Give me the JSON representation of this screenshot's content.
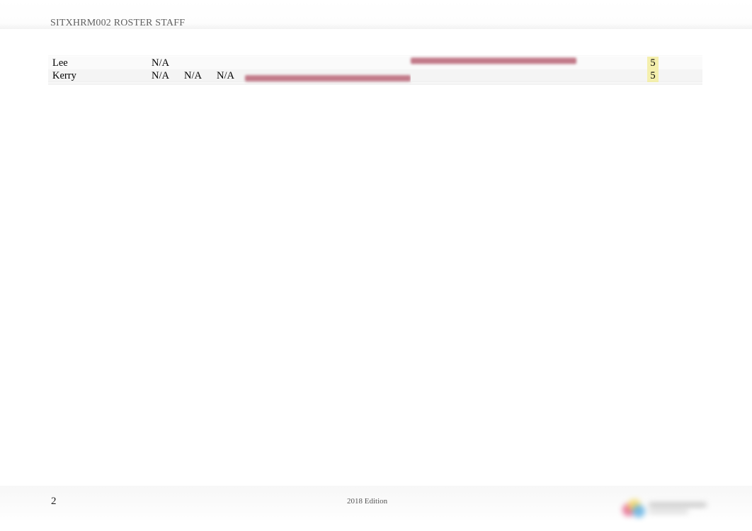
{
  "header": {
    "title": "SITXHRM002 ROSTER STAFF"
  },
  "table": {
    "rows": [
      {
        "name": "Lee",
        "c1": "N/A",
        "c2": "",
        "c3": "",
        "total": "5"
      },
      {
        "name": "Kerry",
        "c1": "N/A",
        "c2": "N/A",
        "c3": "N/A",
        "total": "5"
      }
    ]
  },
  "footer": {
    "page_number": "2",
    "edition": "2018 Edition"
  }
}
